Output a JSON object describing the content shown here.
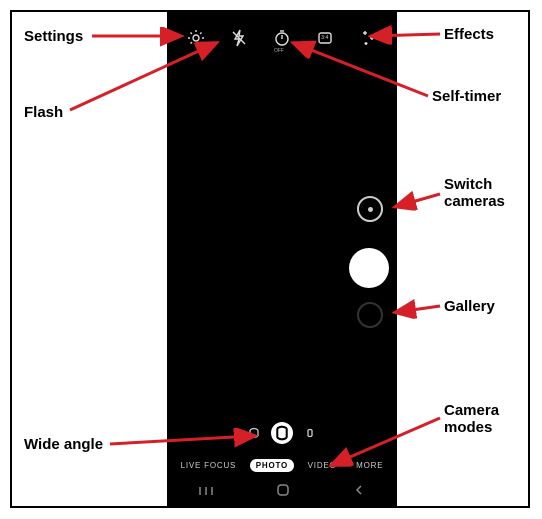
{
  "annotations": {
    "settings": "Settings",
    "flash": "Flash",
    "selftimer": "Self-timer",
    "effects": "Effects",
    "switch": "Switch\ncameras",
    "gallery": "Gallery",
    "modes": "Camera\nmodes",
    "wide": "Wide angle"
  },
  "top_icons": {
    "settings": "settings-gear",
    "flash": "flash-off",
    "timer": "timer-off",
    "ratio": "aspect-ratio",
    "effects": "effects-stars"
  },
  "timer_sub": "OFF",
  "ratio_text": "3:4",
  "modes": {
    "live_focus": "LIVE FOCUS",
    "photo": "PHOTO",
    "video": "VIDEO",
    "more": "MORE"
  }
}
